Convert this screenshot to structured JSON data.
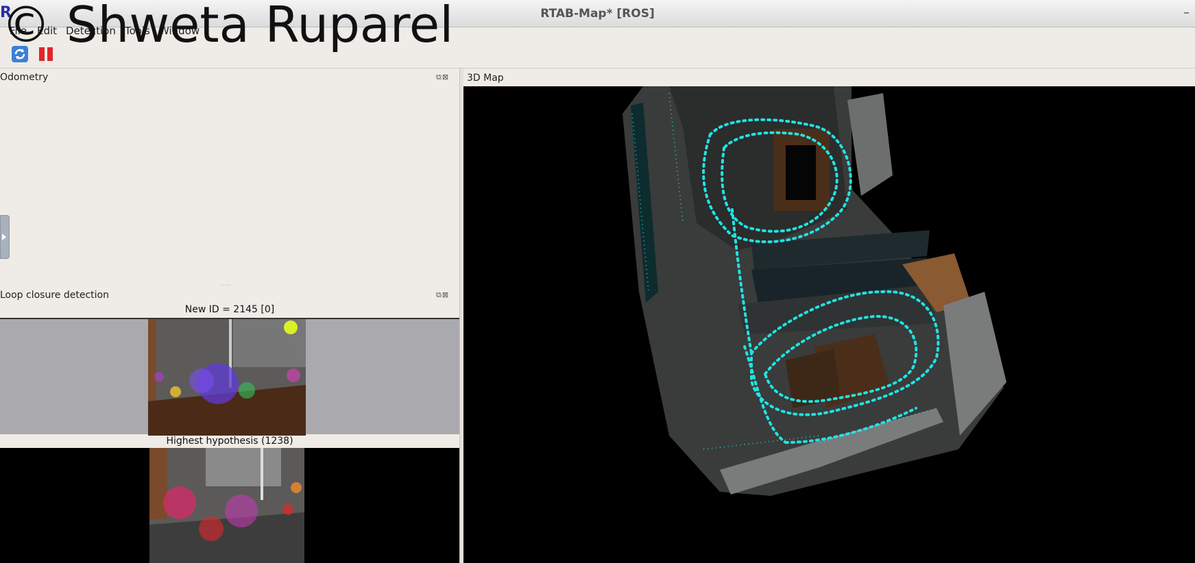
{
  "window": {
    "title": "RTAB-Map* [ROS]",
    "minimize_glyph": "–"
  },
  "watermark": "© Shweta Ruparel",
  "menu": [
    {
      "label": "File"
    },
    {
      "label": "Edit"
    },
    {
      "label": "Detection"
    },
    {
      "label": "Tools"
    },
    {
      "label": "Window"
    }
  ],
  "toolbar": {
    "icons": [
      "refresh-icon",
      "pause-icon"
    ]
  },
  "docks": {
    "odometry": {
      "title": "Odometry"
    },
    "loop_closure": {
      "title": "Loop closure detection",
      "new_label": "New ID = 2145 [0]",
      "hypothesis_label": "Highest hypothesis (1238)"
    },
    "map3d": {
      "title": "3D Map"
    }
  },
  "colors": {
    "trajectory": "#1fe3e3",
    "background": "#000000",
    "panel": "#efebe7"
  }
}
